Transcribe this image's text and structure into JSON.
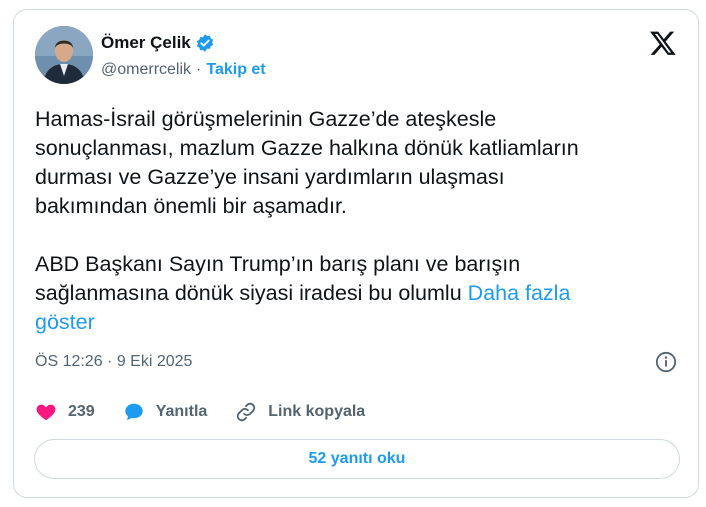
{
  "author": {
    "name": "Ömer Çelik",
    "handle": "@omerrcelik",
    "separator": "·",
    "follow_label": "Takip et"
  },
  "tweet": {
    "paragraph1": "Hamas-İsrail görüşmelerinin Gazze’de ateşkesle\nsonuçlanması, mazlum Gazze halkına dönük katliamların\ndurması ve Gazze’ye insani yardımların ulaşması\nbakımından önemli bir aşamadır.",
    "paragraph2": "ABD Başkanı Sayın Trump’ın barış planı ve barışın\nsağlanmasına dönük siyasi iradesi bu olumlu ",
    "show_more": "Daha fazla\ngöster",
    "timestamp": "ÖS 12:26 · 9 Eki 2025"
  },
  "actions": {
    "likes": "239",
    "reply_label": "Yanıtla",
    "copy_link_label": "Link kopyala"
  },
  "read_replies_label": "52 yanıtı oku",
  "colors": {
    "accent": "#1d9bf0",
    "like": "#f91880",
    "verified": "#1d9bf0"
  },
  "icons": [
    "verified-badge-icon",
    "x-logo-icon",
    "info-icon",
    "heart-icon",
    "reply-bubble-icon",
    "link-icon"
  ]
}
